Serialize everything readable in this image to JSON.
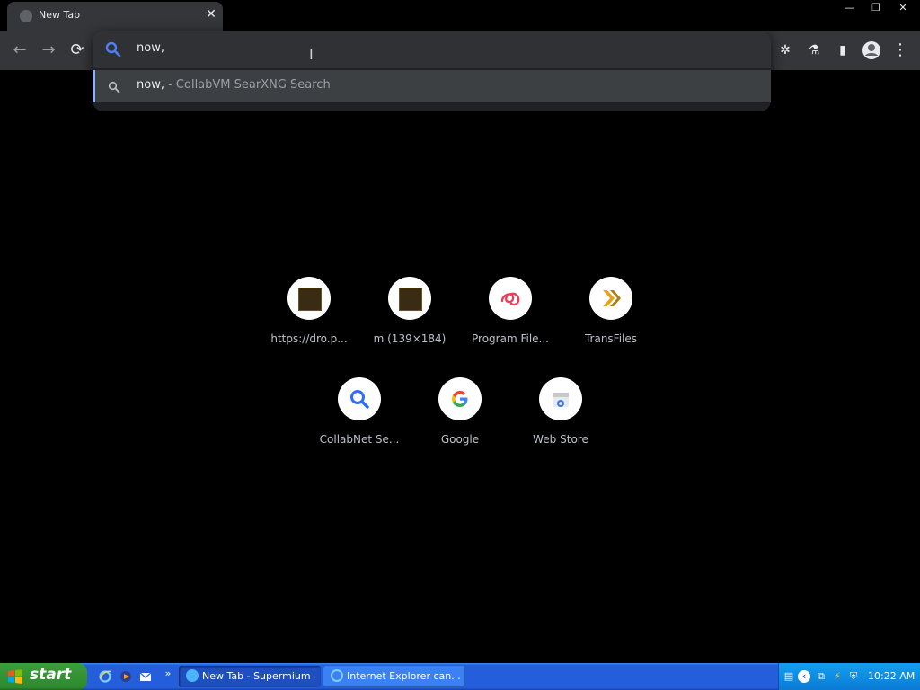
{
  "tab": {
    "title": "New Tab",
    "close_glyph": "✕"
  },
  "window_controls": {
    "minimize": "—",
    "restore": "❐",
    "close": "✕"
  },
  "toolbar": {
    "back_glyph": "←",
    "forward_glyph": "→",
    "reload_glyph": "⟳",
    "extensions_glyph": "✲",
    "labs_glyph": "⚗",
    "sidepanel_glyph": "▮",
    "profile_glyph": "●",
    "menu_glyph": "⋮"
  },
  "omnibox": {
    "value": "now,",
    "suggestion_query": "now,",
    "suggestion_desc": " - CollabVM SearXNG Search"
  },
  "shortcuts": [
    {
      "label": "https://dro.p...",
      "icon": "thumbnail-icon"
    },
    {
      "label": "m (139×184)",
      "icon": "thumbnail-icon"
    },
    {
      "label": "Program File...",
      "icon": "knot-icon"
    },
    {
      "label": "TransFiles",
      "icon": "double-chevron-icon"
    },
    {
      "label": "CollabNet Se...",
      "icon": "magnifier-icon"
    },
    {
      "label": "Google",
      "icon": "google-g-icon"
    },
    {
      "label": "Web Store",
      "icon": "web-store-icon"
    }
  ],
  "taskbar": {
    "start_label": "start",
    "tasks": [
      {
        "label": "New Tab - Supermium"
      },
      {
        "label": "Internet Explorer can..."
      }
    ],
    "quicklaunch_more": "»",
    "clock": "10:22 AM"
  },
  "colors": {
    "accent": "#8ab4f8",
    "taskbar": "#245edb",
    "start": "#3a9a3a"
  }
}
